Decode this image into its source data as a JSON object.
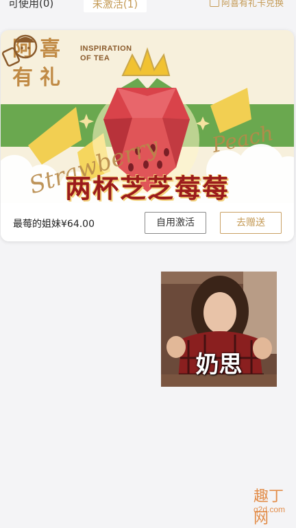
{
  "tabs": {
    "used_label": "可使用(0)",
    "inactive_label": "未激活(1)",
    "redeem_label": "阿喜有礼卡兑换"
  },
  "card": {
    "logo_chars": [
      "阿",
      "喜",
      "有",
      "礼"
    ],
    "inspiration": "INSPIRATION\nOF TEA",
    "script_left": "Strawberry",
    "script_right": "Peach",
    "product_name": "两杯芝芝莓莓",
    "price_text": "最莓的姐妹¥64.00",
    "self_activate_label": "自用激活",
    "gift_label": "去赠送"
  },
  "meme": {
    "caption": "奶思"
  },
  "watermark": {
    "title": "趣丁网",
    "url": "q2d.com"
  },
  "colors": {
    "gold": "#c49a55",
    "banner_green": "#6aa84f",
    "product_red": "#9b1b1b",
    "background": "#f4f4f6"
  }
}
